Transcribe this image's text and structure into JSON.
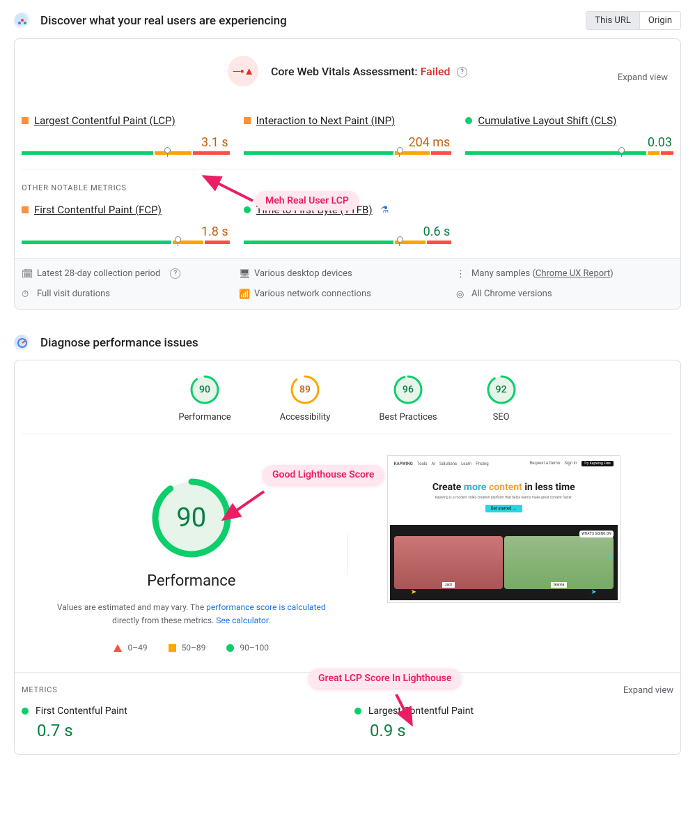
{
  "crux": {
    "title": "Discover what your real users are experiencing",
    "toggle": {
      "this_url": "This URL",
      "origin": "Origin"
    },
    "assessment_label": "Core Web Vitals Assessment: ",
    "assessment_result": "Failed",
    "expand": "Expand view",
    "metrics": [
      {
        "name": "Largest Contentful Paint (LCP)",
        "value": "3.1 s",
        "status": "orange",
        "bar": {
          "g": 64,
          "o": 18,
          "r": 18
        },
        "marker": 70
      },
      {
        "name": "Interaction to Next Paint (INP)",
        "value": "204 ms",
        "status": "orange",
        "bar": {
          "g": 73,
          "o": 17,
          "r": 10
        },
        "marker": 75
      },
      {
        "name": "Cumulative Layout Shift (CLS)",
        "value": "0.03",
        "status": "green",
        "bar": {
          "g": 88,
          "o": 6,
          "r": 6
        },
        "marker": 75
      }
    ],
    "other_label": "OTHER NOTABLE METRICS",
    "other": [
      {
        "name": "First Contentful Paint (FCP)",
        "value": "1.8 s",
        "status": "orange",
        "bar": {
          "g": 73,
          "o": 15,
          "r": 12
        },
        "marker": 75
      },
      {
        "name": "Time to First Byte (TTFB)",
        "value": "0.6 s",
        "status": "green",
        "flask": true,
        "bar": {
          "g": 73,
          "o": 15,
          "r": 12
        },
        "marker": 75
      }
    ],
    "footer": {
      "period": "Latest 28-day collection period",
      "devices": "Various desktop devices",
      "samples_prefix": "Many samples (",
      "samples_link": "Chrome UX Report",
      "samples_suffix": ")",
      "durations": "Full visit durations",
      "network": "Various network connections",
      "chrome": "All Chrome versions"
    }
  },
  "callouts": {
    "meh": "Meh Real User LCP",
    "good": "Good Lighthouse Score",
    "great": "Great LCP Score In Lighthouse"
  },
  "lh": {
    "title": "Diagnose performance issues",
    "scores": [
      {
        "label": "Performance",
        "value": "90",
        "pct": 90,
        "color": "green"
      },
      {
        "label": "Accessibility",
        "value": "89",
        "pct": 89,
        "color": "orange"
      },
      {
        "label": "Best Practices",
        "value": "96",
        "pct": 96,
        "color": "green"
      },
      {
        "label": "SEO",
        "value": "92",
        "pct": 92,
        "color": "green"
      }
    ],
    "big": {
      "value": "90",
      "pct": 90,
      "title": "Performance"
    },
    "desc1": "Values are estimated and may vary. The ",
    "desc_link1": "performance score is calculated",
    "desc2": " directly from these metrics. ",
    "desc_link2": "See calculator.",
    "legend": {
      "poor": "0–49",
      "mid": "50–89",
      "good": "90–100"
    },
    "metrics_label": "METRICS",
    "expand": "Expand view",
    "metrics": [
      {
        "name": "First Contentful Paint",
        "value": "0.7 s"
      },
      {
        "name": "Largest Contentful Paint",
        "value": "0.9 s"
      }
    ],
    "thumb": {
      "brand": "KAPWING",
      "nav": [
        "Tools",
        "AI",
        "Solutions",
        "Learn",
        "Pricing"
      ],
      "req": "Request a Demo",
      "signin": "Sign In",
      "try": "Try Kapwing Free",
      "hero_a": "Create ",
      "hero_b": "more ",
      "hero_c": "content ",
      "hero_d": "in less time",
      "sub": "Kapwing is a modern video creation platform\nthat helps teams make great content faster.",
      "cta": "Get started →",
      "face1": "Jack",
      "face2": "Gianna",
      "speech": "WHAT'S GOING ON"
    }
  }
}
